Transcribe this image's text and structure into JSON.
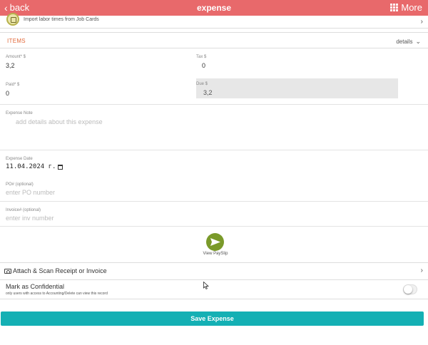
{
  "header": {
    "back_label": "back",
    "title": "expense",
    "more_label": "More",
    "color": "#e8696b"
  },
  "import_row": {
    "label": "Import labor times from Job Cards",
    "icon": "job-card-icon"
  },
  "items_section": {
    "title": "ITEMS",
    "details_label": "details",
    "accent_color": "#e26a3b"
  },
  "fields": {
    "amount": {
      "label": "Amount* $",
      "value": "3,2"
    },
    "tax": {
      "label": "Tax $",
      "value": "0"
    },
    "paid": {
      "label": "Paid* $",
      "value": "0"
    },
    "due": {
      "label": "Due $",
      "value": "3,2"
    },
    "note": {
      "label": "Expense Note",
      "placeholder": "add details about this expense"
    },
    "date": {
      "label": "Expense Date",
      "value": "11.04.2024 г."
    },
    "po": {
      "label": "PO# (optional)",
      "placeholder": "enter PO number"
    },
    "invoice": {
      "label": "Invoice# (optional)",
      "placeholder": "enter inv number"
    }
  },
  "payslip": {
    "label": "View PaySlip",
    "icon": "send-icon",
    "color": "#7a9a2a"
  },
  "attach": {
    "label": "Attach & Scan Receipt or Invoice",
    "icon": "camera-icon"
  },
  "confidential": {
    "title": "Mark as Confidential",
    "subtitle": "only users with access to Accounting/Delete can view this record",
    "enabled": false
  },
  "save": {
    "label": "Save Expense",
    "color": "#14b0b4"
  }
}
